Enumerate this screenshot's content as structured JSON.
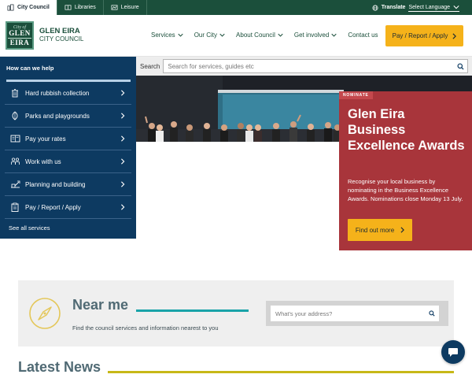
{
  "colors": {
    "topbar_green": "#1b4f3b",
    "help_navy": "#0d3a61",
    "cta_yellow": "#f5b21a",
    "feature_red": "#a8353b",
    "teal_rule": "#19a3a8",
    "olive_rule": "#c7b818"
  },
  "topbar": {
    "sites": [
      {
        "label": "City Council",
        "icon": "city-building-icon",
        "active": true
      },
      {
        "label": "Libraries",
        "icon": "book-icon",
        "active": false
      },
      {
        "label": "Leisure",
        "icon": "leisure-icon",
        "active": false
      }
    ],
    "translate_label": "Translate",
    "language_select": "Select Language"
  },
  "header": {
    "logo": {
      "city_of": "City of",
      "glen": "GLEN",
      "eira": "EIRA",
      "line1": "GLEN EIRA",
      "line2": "CITY COUNCIL"
    },
    "nav": [
      {
        "label": "Services",
        "has_dropdown": true
      },
      {
        "label": "Our City",
        "has_dropdown": true
      },
      {
        "label": "About Council",
        "has_dropdown": true
      },
      {
        "label": "Get involved",
        "has_dropdown": true
      },
      {
        "label": "Contact us",
        "has_dropdown": false
      }
    ],
    "cta": "Pay / Report / Apply"
  },
  "search": {
    "label": "Search",
    "placeholder": "Search for services, guides etc"
  },
  "help": {
    "title": "How can we help",
    "items": [
      {
        "label": "Hard rubbish collection",
        "icon": "bin-icon"
      },
      {
        "label": "Parks and playgrounds",
        "icon": "leaf-icon"
      },
      {
        "label": "Pay your rates",
        "icon": "rates-icon"
      },
      {
        "label": "Work with us",
        "icon": "people-icon"
      },
      {
        "label": "Planning and building",
        "icon": "planning-icon"
      },
      {
        "label": "Pay / Report / Apply",
        "icon": "clipboard-icon"
      }
    ],
    "see_all": "See all services"
  },
  "feature": {
    "tag": "NOMINATE",
    "title": "Glen Eira Business Excellence Awards",
    "description": "Recognise your local business by nominating in the Business Excellence Awards. Nominations close Monday 13 July.",
    "button": "Find out more"
  },
  "near_me": {
    "heading": "Near me",
    "subtext": "Find the council services and information nearest to you",
    "placeholder": "What's your address?"
  },
  "news": {
    "heading": "Latest News"
  }
}
